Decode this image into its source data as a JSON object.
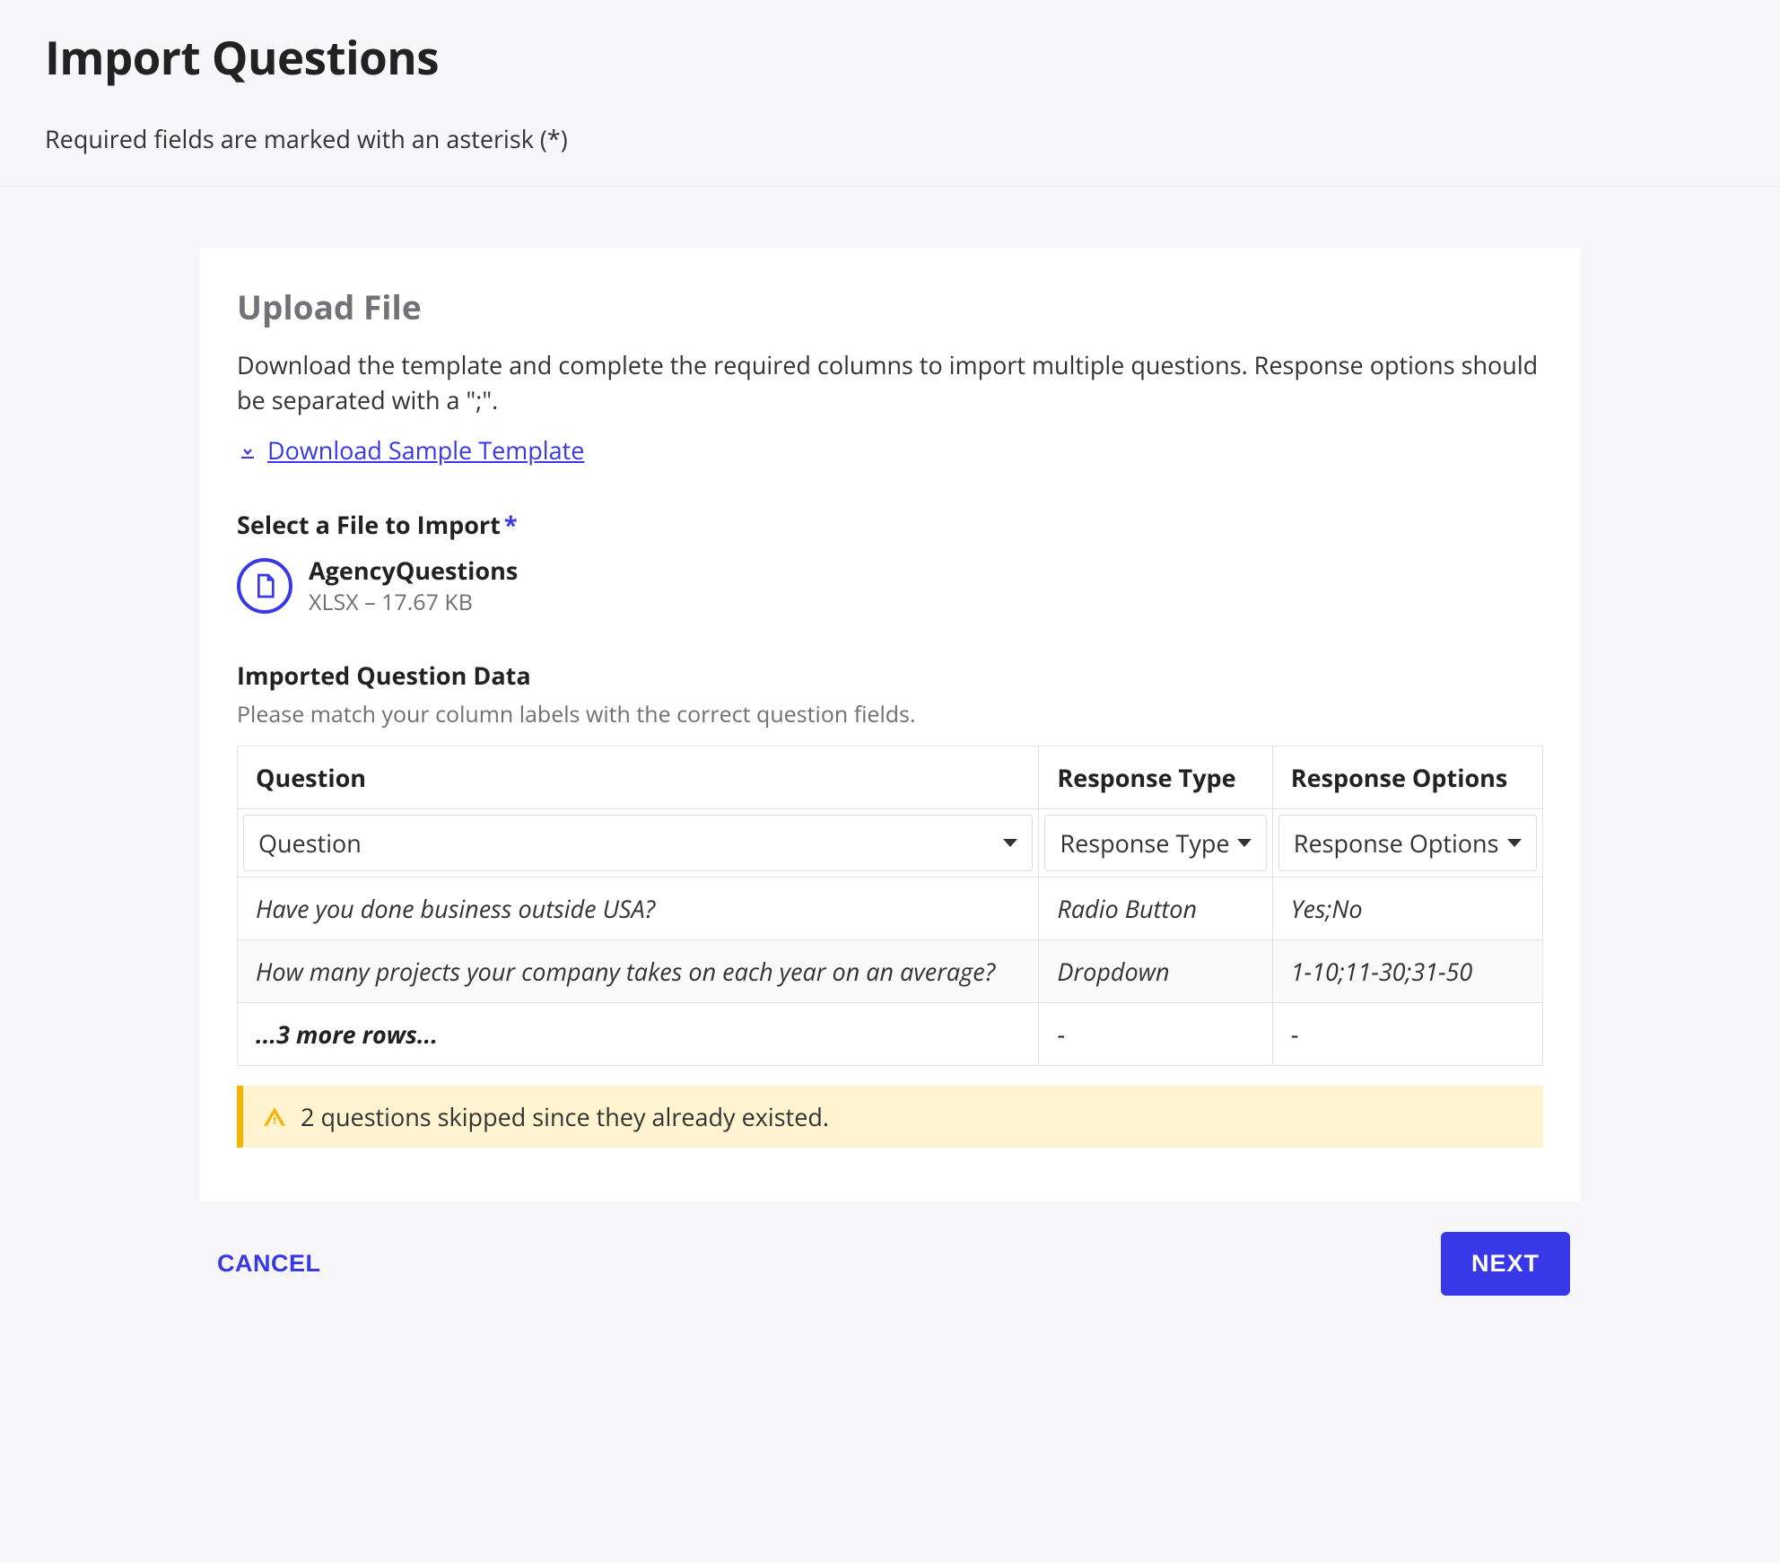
{
  "header": {
    "title": "Import Questions",
    "subtitle": "Required fields are marked with an asterisk (*)"
  },
  "upload": {
    "section_title": "Upload File",
    "description": "Download the template and complete the required columns to import multiple questions. Response options should be separated with a \";\".",
    "download_link_label": "Download Sample Template",
    "select_file_label": "Select a File to Import",
    "file": {
      "name": "AgencyQuestions",
      "type": "XLSX",
      "size": "17.67 KB"
    }
  },
  "imported": {
    "title": "Imported Question Data",
    "subtitle": "Please match your column labels with the correct question fields.",
    "columns": [
      "Question",
      "Response Type",
      "Response Options"
    ],
    "selects": [
      "Question",
      "Response Type",
      "Response Options"
    ],
    "rows": [
      {
        "question": "Have you done business outside USA?",
        "response_type": "Radio Button",
        "response_options": "Yes;No"
      },
      {
        "question": "How many projects your company takes on each year on an average?",
        "response_type": "Dropdown",
        "response_options": "1-10;11-30;31-50"
      }
    ],
    "more_rows_label": "...3 more rows...",
    "more_rows_dash": "-"
  },
  "alert": {
    "message": "2 questions skipped since they already existed."
  },
  "footer": {
    "cancel": "CANCEL",
    "next": "NEXT"
  }
}
